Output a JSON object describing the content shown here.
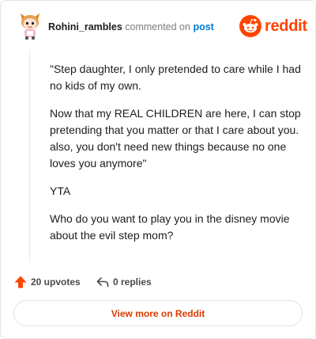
{
  "header": {
    "author": "Rohini_rambles",
    "commented_text": "commented on",
    "post_link": "post",
    "avatar_icon": "snoo-avatar-icon",
    "brand_icon": "reddit-alien-icon",
    "brand_name": "reddit"
  },
  "comment": {
    "paragraphs": [
      "\"Step daughter, I only pretended to care while I had no kids of my own.",
      "Now that my REAL CHILDREN are here, I can stop pretending that you matter or that I care about you. also, you don't need new things because no one loves you anymore\"",
      "YTA",
      "Who do you want to play you in the disney movie about the evil step mom?"
    ]
  },
  "footer": {
    "upvotes": "20 upvotes",
    "upvote_icon": "upvote-arrow-icon",
    "replies": "0 replies",
    "reply_icon": "reply-arrow-icon"
  },
  "cta": {
    "label": "View more on Reddit"
  },
  "colors": {
    "brand": "#ff4500",
    "link": "#0079d3",
    "cta_text": "#d93a00"
  }
}
